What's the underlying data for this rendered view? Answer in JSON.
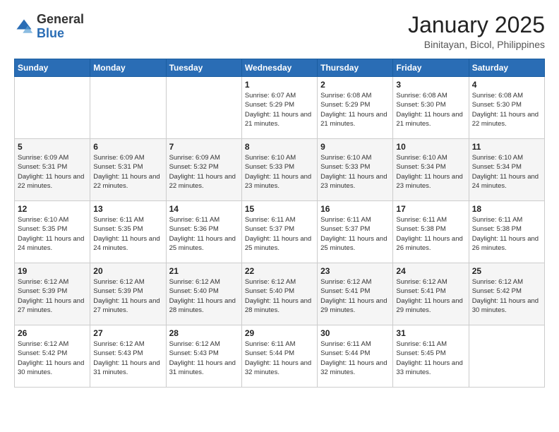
{
  "header": {
    "logo_general": "General",
    "logo_blue": "Blue",
    "main_title": "January 2025",
    "subtitle": "Binitayan, Bicol, Philippines"
  },
  "weekdays": [
    "Sunday",
    "Monday",
    "Tuesday",
    "Wednesday",
    "Thursday",
    "Friday",
    "Saturday"
  ],
  "weeks": [
    [
      {
        "day": "",
        "sunrise": "",
        "sunset": "",
        "daylight": ""
      },
      {
        "day": "",
        "sunrise": "",
        "sunset": "",
        "daylight": ""
      },
      {
        "day": "",
        "sunrise": "",
        "sunset": "",
        "daylight": ""
      },
      {
        "day": "1",
        "sunrise": "Sunrise: 6:07 AM",
        "sunset": "Sunset: 5:29 PM",
        "daylight": "Daylight: 11 hours and 21 minutes."
      },
      {
        "day": "2",
        "sunrise": "Sunrise: 6:08 AM",
        "sunset": "Sunset: 5:29 PM",
        "daylight": "Daylight: 11 hours and 21 minutes."
      },
      {
        "day": "3",
        "sunrise": "Sunrise: 6:08 AM",
        "sunset": "Sunset: 5:30 PM",
        "daylight": "Daylight: 11 hours and 21 minutes."
      },
      {
        "day": "4",
        "sunrise": "Sunrise: 6:08 AM",
        "sunset": "Sunset: 5:30 PM",
        "daylight": "Daylight: 11 hours and 22 minutes."
      }
    ],
    [
      {
        "day": "5",
        "sunrise": "Sunrise: 6:09 AM",
        "sunset": "Sunset: 5:31 PM",
        "daylight": "Daylight: 11 hours and 22 minutes."
      },
      {
        "day": "6",
        "sunrise": "Sunrise: 6:09 AM",
        "sunset": "Sunset: 5:31 PM",
        "daylight": "Daylight: 11 hours and 22 minutes."
      },
      {
        "day": "7",
        "sunrise": "Sunrise: 6:09 AM",
        "sunset": "Sunset: 5:32 PM",
        "daylight": "Daylight: 11 hours and 22 minutes."
      },
      {
        "day": "8",
        "sunrise": "Sunrise: 6:10 AM",
        "sunset": "Sunset: 5:33 PM",
        "daylight": "Daylight: 11 hours and 23 minutes."
      },
      {
        "day": "9",
        "sunrise": "Sunrise: 6:10 AM",
        "sunset": "Sunset: 5:33 PM",
        "daylight": "Daylight: 11 hours and 23 minutes."
      },
      {
        "day": "10",
        "sunrise": "Sunrise: 6:10 AM",
        "sunset": "Sunset: 5:34 PM",
        "daylight": "Daylight: 11 hours and 23 minutes."
      },
      {
        "day": "11",
        "sunrise": "Sunrise: 6:10 AM",
        "sunset": "Sunset: 5:34 PM",
        "daylight": "Daylight: 11 hours and 24 minutes."
      }
    ],
    [
      {
        "day": "12",
        "sunrise": "Sunrise: 6:10 AM",
        "sunset": "Sunset: 5:35 PM",
        "daylight": "Daylight: 11 hours and 24 minutes."
      },
      {
        "day": "13",
        "sunrise": "Sunrise: 6:11 AM",
        "sunset": "Sunset: 5:35 PM",
        "daylight": "Daylight: 11 hours and 24 minutes."
      },
      {
        "day": "14",
        "sunrise": "Sunrise: 6:11 AM",
        "sunset": "Sunset: 5:36 PM",
        "daylight": "Daylight: 11 hours and 25 minutes."
      },
      {
        "day": "15",
        "sunrise": "Sunrise: 6:11 AM",
        "sunset": "Sunset: 5:37 PM",
        "daylight": "Daylight: 11 hours and 25 minutes."
      },
      {
        "day": "16",
        "sunrise": "Sunrise: 6:11 AM",
        "sunset": "Sunset: 5:37 PM",
        "daylight": "Daylight: 11 hours and 25 minutes."
      },
      {
        "day": "17",
        "sunrise": "Sunrise: 6:11 AM",
        "sunset": "Sunset: 5:38 PM",
        "daylight": "Daylight: 11 hours and 26 minutes."
      },
      {
        "day": "18",
        "sunrise": "Sunrise: 6:11 AM",
        "sunset": "Sunset: 5:38 PM",
        "daylight": "Daylight: 11 hours and 26 minutes."
      }
    ],
    [
      {
        "day": "19",
        "sunrise": "Sunrise: 6:12 AM",
        "sunset": "Sunset: 5:39 PM",
        "daylight": "Daylight: 11 hours and 27 minutes."
      },
      {
        "day": "20",
        "sunrise": "Sunrise: 6:12 AM",
        "sunset": "Sunset: 5:39 PM",
        "daylight": "Daylight: 11 hours and 27 minutes."
      },
      {
        "day": "21",
        "sunrise": "Sunrise: 6:12 AM",
        "sunset": "Sunset: 5:40 PM",
        "daylight": "Daylight: 11 hours and 28 minutes."
      },
      {
        "day": "22",
        "sunrise": "Sunrise: 6:12 AM",
        "sunset": "Sunset: 5:40 PM",
        "daylight": "Daylight: 11 hours and 28 minutes."
      },
      {
        "day": "23",
        "sunrise": "Sunrise: 6:12 AM",
        "sunset": "Sunset: 5:41 PM",
        "daylight": "Daylight: 11 hours and 29 minutes."
      },
      {
        "day": "24",
        "sunrise": "Sunrise: 6:12 AM",
        "sunset": "Sunset: 5:41 PM",
        "daylight": "Daylight: 11 hours and 29 minutes."
      },
      {
        "day": "25",
        "sunrise": "Sunrise: 6:12 AM",
        "sunset": "Sunset: 5:42 PM",
        "daylight": "Daylight: 11 hours and 30 minutes."
      }
    ],
    [
      {
        "day": "26",
        "sunrise": "Sunrise: 6:12 AM",
        "sunset": "Sunset: 5:42 PM",
        "daylight": "Daylight: 11 hours and 30 minutes."
      },
      {
        "day": "27",
        "sunrise": "Sunrise: 6:12 AM",
        "sunset": "Sunset: 5:43 PM",
        "daylight": "Daylight: 11 hours and 31 minutes."
      },
      {
        "day": "28",
        "sunrise": "Sunrise: 6:12 AM",
        "sunset": "Sunset: 5:43 PM",
        "daylight": "Daylight: 11 hours and 31 minutes."
      },
      {
        "day": "29",
        "sunrise": "Sunrise: 6:11 AM",
        "sunset": "Sunset: 5:44 PM",
        "daylight": "Daylight: 11 hours and 32 minutes."
      },
      {
        "day": "30",
        "sunrise": "Sunrise: 6:11 AM",
        "sunset": "Sunset: 5:44 PM",
        "daylight": "Daylight: 11 hours and 32 minutes."
      },
      {
        "day": "31",
        "sunrise": "Sunrise: 6:11 AM",
        "sunset": "Sunset: 5:45 PM",
        "daylight": "Daylight: 11 hours and 33 minutes."
      },
      {
        "day": "",
        "sunrise": "",
        "sunset": "",
        "daylight": ""
      }
    ]
  ]
}
